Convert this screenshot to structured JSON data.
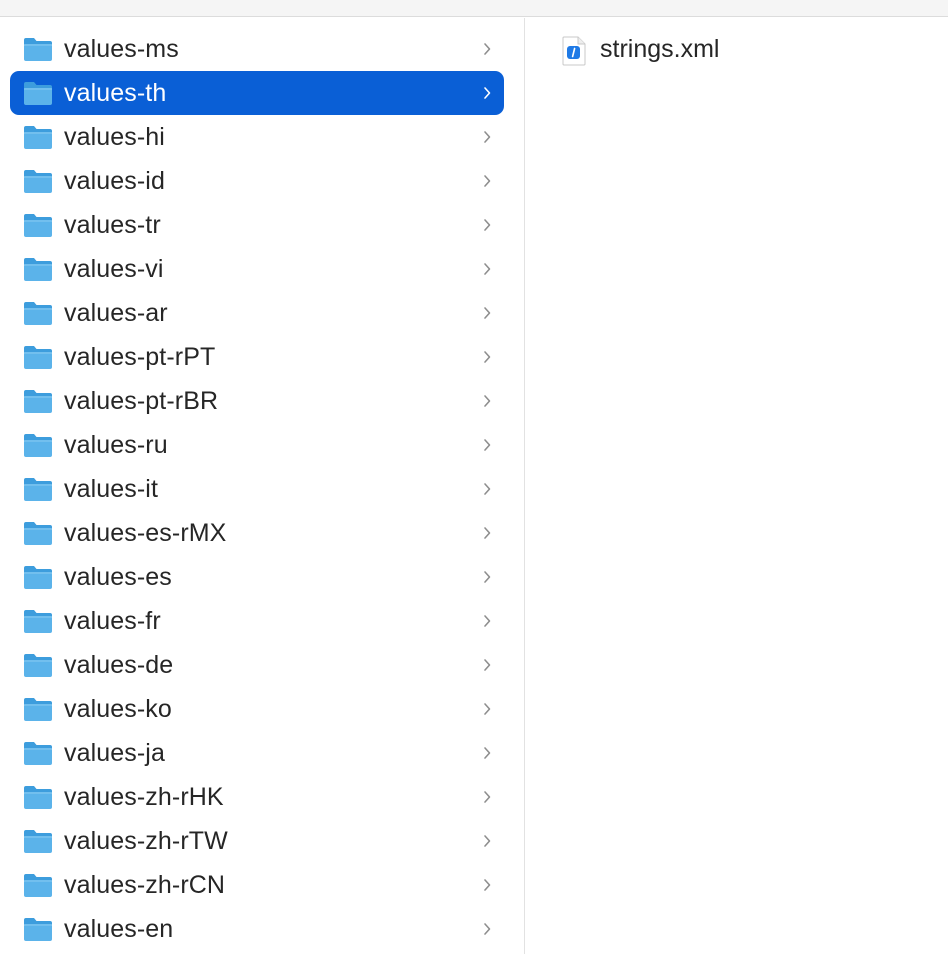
{
  "colors": {
    "selection": "#0a5fd6",
    "folder_body": "#5bb3ea",
    "folder_tab": "#3d9ddd",
    "text": "#262626",
    "chevron": "#8e8e8e"
  },
  "left_column": {
    "folders": [
      {
        "label": "values-ms",
        "selected": false
      },
      {
        "label": "values-th",
        "selected": true
      },
      {
        "label": "values-hi",
        "selected": false
      },
      {
        "label": "values-id",
        "selected": false
      },
      {
        "label": "values-tr",
        "selected": false
      },
      {
        "label": "values-vi",
        "selected": false
      },
      {
        "label": "values-ar",
        "selected": false
      },
      {
        "label": "values-pt-rPT",
        "selected": false
      },
      {
        "label": "values-pt-rBR",
        "selected": false
      },
      {
        "label": "values-ru",
        "selected": false
      },
      {
        "label": "values-it",
        "selected": false
      },
      {
        "label": "values-es-rMX",
        "selected": false
      },
      {
        "label": "values-es",
        "selected": false
      },
      {
        "label": "values-fr",
        "selected": false
      },
      {
        "label": "values-de",
        "selected": false
      },
      {
        "label": "values-ko",
        "selected": false
      },
      {
        "label": "values-ja",
        "selected": false
      },
      {
        "label": "values-zh-rHK",
        "selected": false
      },
      {
        "label": "values-zh-rTW",
        "selected": false
      },
      {
        "label": "values-zh-rCN",
        "selected": false
      },
      {
        "label": "values-en",
        "selected": false
      }
    ]
  },
  "right_column": {
    "files": [
      {
        "label": "strings.xml",
        "icon": "xml-file-icon"
      }
    ]
  }
}
